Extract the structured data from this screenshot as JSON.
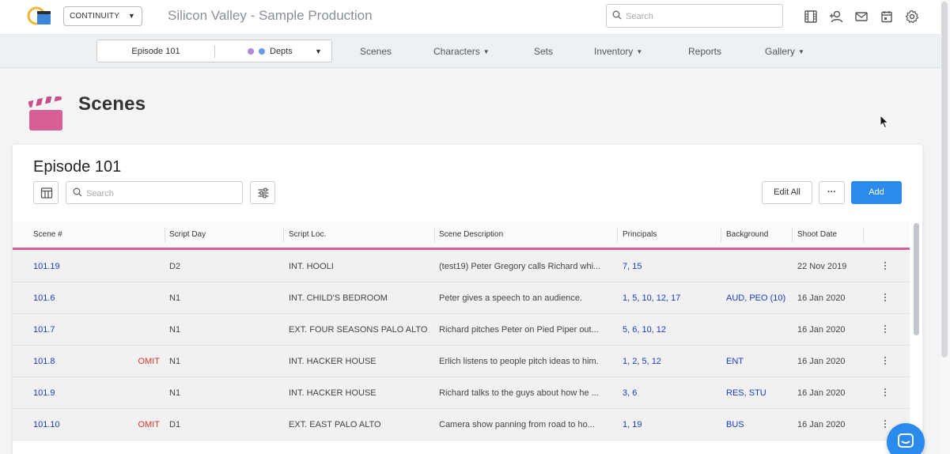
{
  "app": {
    "module_select": "CONTINUITY",
    "production_title": "Silicon Valley - Sample Production",
    "search_placeholder": "Search",
    "top_icons": [
      "film-icon",
      "add-user-icon",
      "mail-icon",
      "calendar-icon",
      "gear-icon"
    ]
  },
  "nav": {
    "episode_select": "Episode 101",
    "depts_label": "Depts",
    "dept_dot_colors": [
      "#b388d9",
      "#6b9be6"
    ],
    "items": [
      {
        "label": "Scenes",
        "dropdown": false
      },
      {
        "label": "Characters",
        "dropdown": true
      },
      {
        "label": "Sets",
        "dropdown": false
      },
      {
        "label": "Inventory",
        "dropdown": true
      },
      {
        "label": "Reports",
        "dropdown": false
      },
      {
        "label": "Gallery",
        "dropdown": true
      }
    ]
  },
  "page": {
    "title": "Scenes",
    "icon": "clapperboard-icon",
    "icon_color": "#d85f94"
  },
  "card": {
    "title": "Episode 101",
    "search_placeholder": "Search",
    "edit_all_label": "Edit All",
    "more_label": "···",
    "add_label": "Add",
    "accent_color": "#2a8bed"
  },
  "table": {
    "columns": [
      "Scene #",
      "Script Day",
      "Script Loc.",
      "Scene Description",
      "Principals",
      "Background",
      "Shoot Date"
    ],
    "rows": [
      {
        "scene": "101.19",
        "omit": "",
        "day": "D2",
        "loc": "INT. HOOLI",
        "desc": "(test19) Peter Gregory calls Richard whi...",
        "principals": "7, 15",
        "background": "",
        "date": "22 Nov 2019"
      },
      {
        "scene": "101.6",
        "omit": "",
        "day": "N1",
        "loc": "INT. CHILD'S BEDROOM",
        "desc": "Peter gives a speech to an audience.",
        "principals": "1, 5, 10, 12, 17",
        "background": "AUD, PEO (10)",
        "date": "16 Jan 2020"
      },
      {
        "scene": "101.7",
        "omit": "",
        "day": "N1",
        "loc": "EXT. FOUR SEASONS PALO ALTO",
        "desc": "Richard pitches Peter on Pied Piper out...",
        "principals": "5, 6, 10, 12",
        "background": "",
        "date": "16 Jan 2020"
      },
      {
        "scene": "101.8",
        "omit": "OMIT",
        "day": "N1",
        "loc": "INT. HACKER HOUSE",
        "desc": "Erlich listens to people pitch ideas to him.",
        "principals": "1, 2, 5, 12",
        "background": "ENT",
        "date": "16 Jan 2020"
      },
      {
        "scene": "101.9",
        "omit": "",
        "day": "N1",
        "loc": "INT. HACKER HOUSE",
        "desc": "Richard talks to the guys about how he ...",
        "principals": "3, 6",
        "background": "RES, STU",
        "date": "16 Jan 2020"
      },
      {
        "scene": "101.10",
        "omit": "OMIT",
        "day": "D1",
        "loc": "EXT. EAST PALO ALTO",
        "desc": "Camera show panning from road to ho...",
        "principals": "1, 19",
        "background": "BUS",
        "date": "16 Jan 2020"
      }
    ]
  }
}
